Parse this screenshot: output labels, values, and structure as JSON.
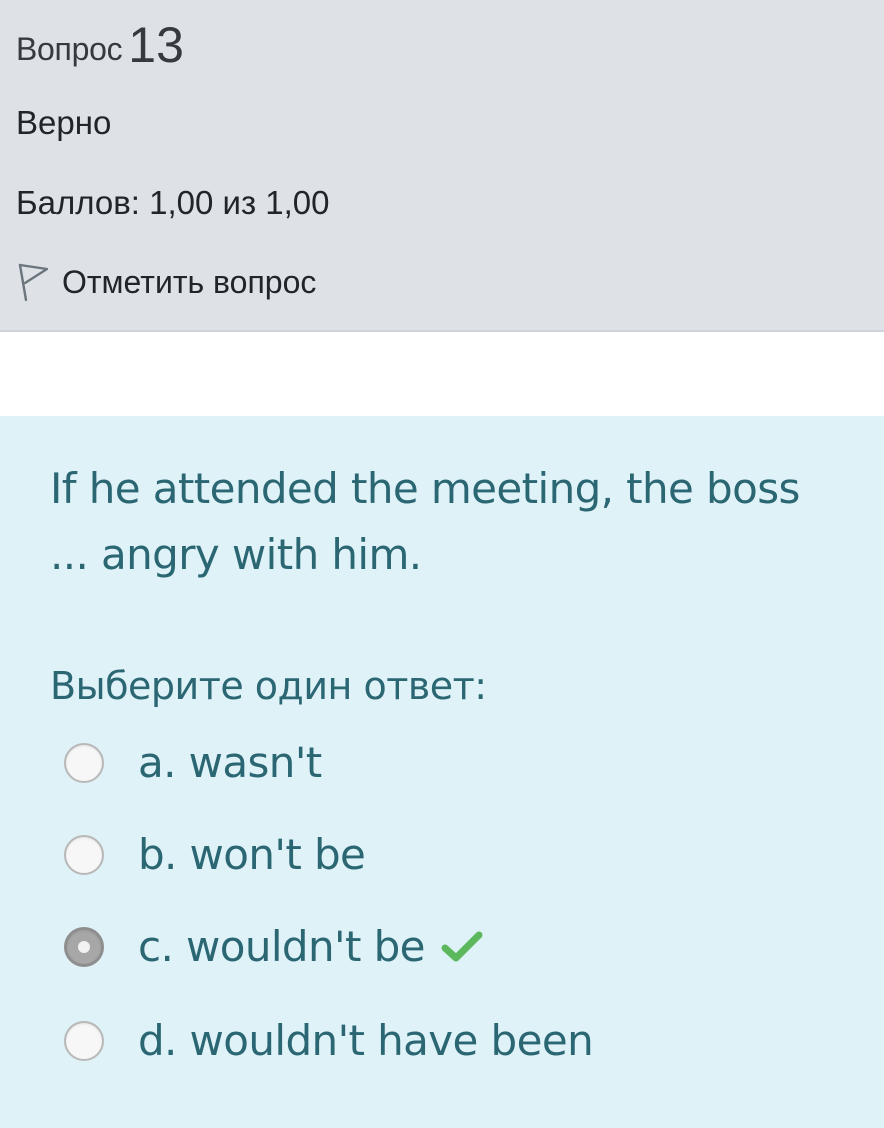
{
  "question": {
    "label": "Вопрос",
    "number": "13",
    "state": "Верно",
    "grade": "Баллов: 1,00 из 1,00",
    "flag_label": "Отметить вопрос"
  },
  "formulation": {
    "text": "If he attended the meeting, the boss ... angry with him.",
    "prompt": "Выберите один ответ:",
    "answers": [
      {
        "label": "a. wasn't",
        "selected": false,
        "correct": false
      },
      {
        "label": "b. won't be",
        "selected": false,
        "correct": false
      },
      {
        "label": "c. wouldn't be",
        "selected": true,
        "correct": true
      },
      {
        "label": "d. wouldn't have been",
        "selected": false,
        "correct": false
      }
    ]
  },
  "colors": {
    "info_background": "#dee2e6",
    "formulation_background": "#def2f8",
    "text_accent": "#2b6673",
    "correct_check": "#5cb85c"
  },
  "icons": {
    "flag": "flag-outline-icon",
    "correct": "check-icon"
  }
}
